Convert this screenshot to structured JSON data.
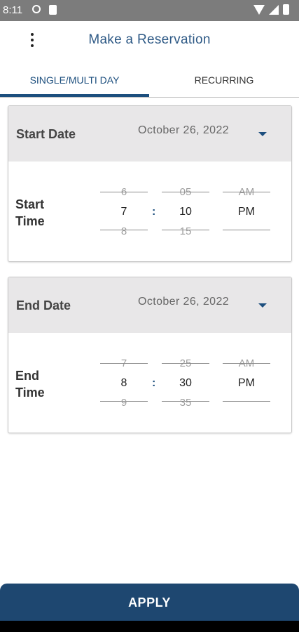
{
  "status_bar": {
    "time": "8:11"
  },
  "app_bar": {
    "title": "Make a Reservation"
  },
  "tabs": [
    {
      "label": "SINGLE/MULTI DAY",
      "selected": true
    },
    {
      "label": "RECURRING",
      "selected": false
    }
  ],
  "start": {
    "date_label": "Start Date",
    "date_value": "October 26, 2022",
    "time_label_line1": "Start",
    "time_label_line2": "Time",
    "hour": {
      "prev": "6",
      "selected": "7",
      "next": "8"
    },
    "minute": {
      "prev": "05",
      "selected": "10",
      "next": "15"
    },
    "ampm": {
      "prev": "AM",
      "selected": "PM",
      "next": ""
    },
    "separator": ":"
  },
  "end": {
    "date_label": "End Date",
    "date_value": "October 26, 2022",
    "time_label_line1": "End",
    "time_label_line2": "Time",
    "hour": {
      "prev": "7",
      "selected": "8",
      "next": "9"
    },
    "minute": {
      "prev": "25",
      "selected": "30",
      "next": "35"
    },
    "ampm": {
      "prev": "AM",
      "selected": "PM",
      "next": ""
    },
    "separator": ":"
  },
  "apply": {
    "label": "APPLY"
  },
  "colors": {
    "accent": "#1d4f7e",
    "apply_bg": "#1e4770",
    "date_row_bg": "#e8e7e8"
  }
}
